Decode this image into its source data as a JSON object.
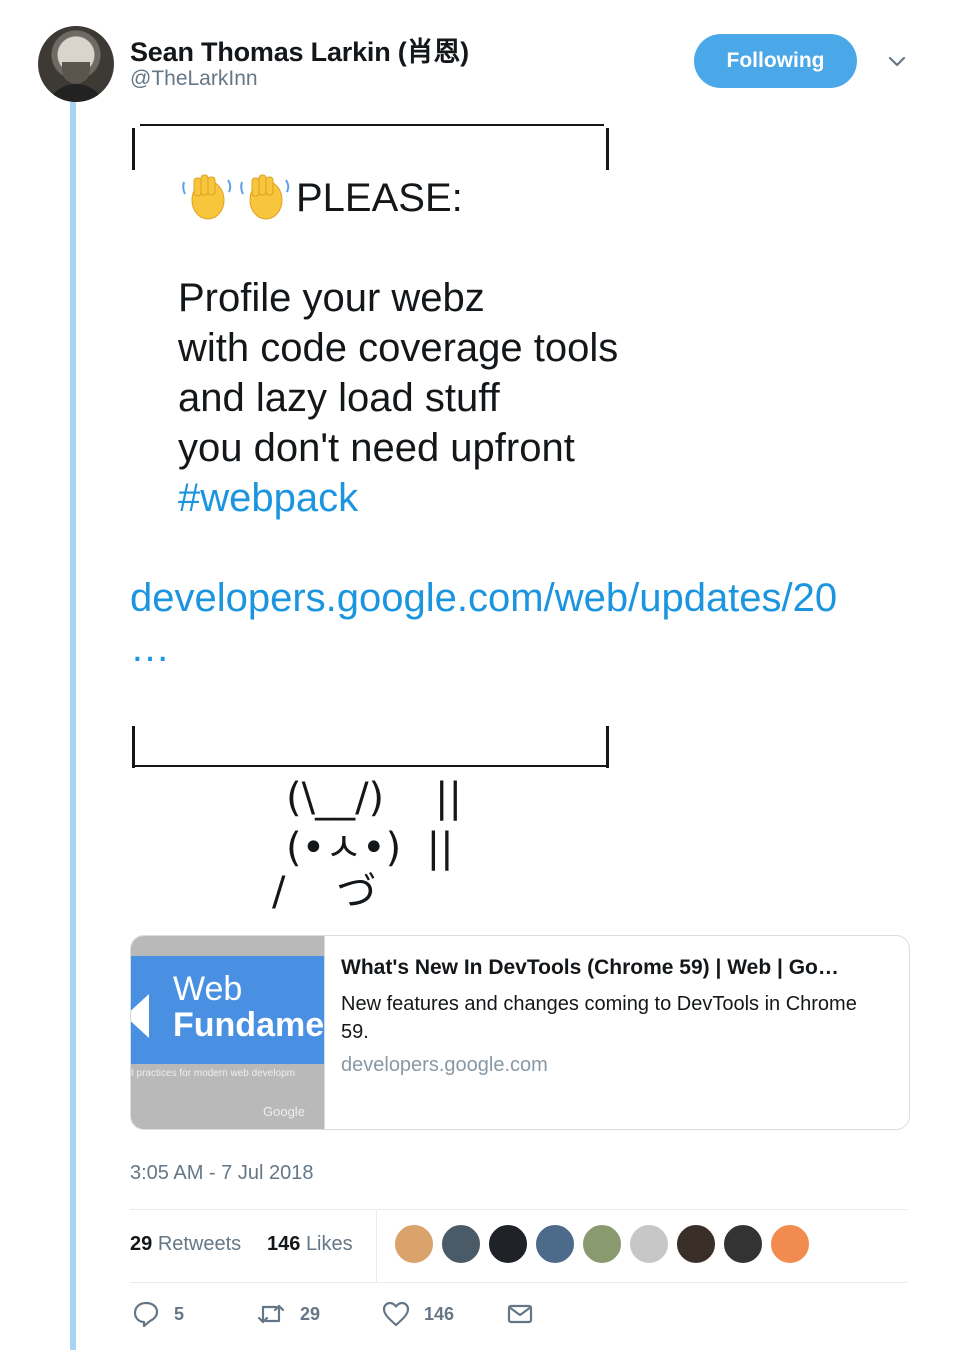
{
  "author": {
    "name": "Sean Thomas Larkin (肖恩)",
    "handle": "@TheLarkInn",
    "follow_label": "Following"
  },
  "tweet": {
    "heading": "PLEASE:",
    "lines": [
      "Profile your webz",
      "with code coverage tools",
      "and lazy load stuff",
      "you don't need upfront"
    ],
    "hashtag": "#webpack",
    "link": "developers.google.com/web/updates/20",
    "link_ellipsis": "…",
    "ascii": {
      "line1": "(\\__/)    ||",
      "line2": "(•ㅅ•)  ||",
      "line3": "/    づ"
    }
  },
  "card": {
    "image_text_1": "Web",
    "image_text_2": "Fundamen",
    "image_tagline": "t practices for modern web developm",
    "image_brand": "Google",
    "title": "What's New In DevTools (Chrome 59)  |  Web  |  Go…",
    "description": "New features and changes coming to DevTools in Chrome 59.",
    "domain": "developers.google.com"
  },
  "timestamp": "3:05 AM - 7 Jul 2018",
  "stats": {
    "retweets_count": "29",
    "retweets_label": "Retweets",
    "likes_count": "146",
    "likes_label": "Likes"
  },
  "likers": [
    {
      "name": "liker-1",
      "color": "#d9a36b"
    },
    {
      "name": "liker-2",
      "color": "#4a5a66"
    },
    {
      "name": "liker-3",
      "color": "#1f2328"
    },
    {
      "name": "liker-4",
      "color": "#4c6a8a"
    },
    {
      "name": "liker-5",
      "color": "#8a9a70"
    },
    {
      "name": "liker-6",
      "color": "#c7c7c7"
    },
    {
      "name": "liker-7",
      "color": "#3a2f28"
    },
    {
      "name": "liker-8",
      "color": "#333333"
    },
    {
      "name": "liker-9",
      "color": "#f28b50"
    }
  ],
  "actions": {
    "reply_count": "5",
    "retweet_count": "29",
    "like_count": "146"
  },
  "colors": {
    "accent": "#1b95e0",
    "follow_button": "#4aa8e8",
    "thread_line": "#a8d4f2",
    "muted": "#657786"
  }
}
